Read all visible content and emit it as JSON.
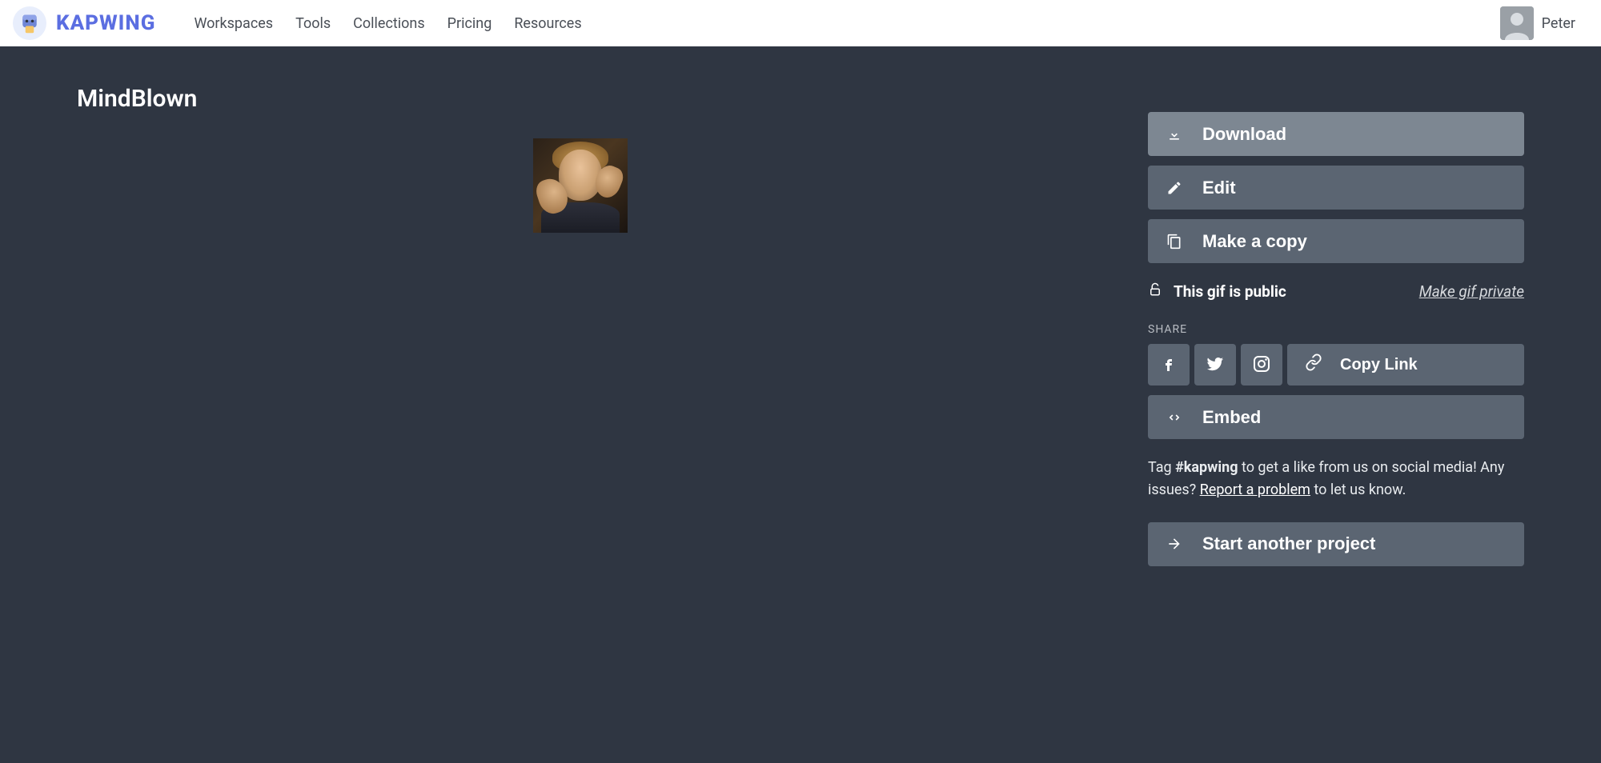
{
  "header": {
    "brand": "KAPWING",
    "nav": [
      "Workspaces",
      "Tools",
      "Collections",
      "Pricing",
      "Resources"
    ],
    "username": "Peter"
  },
  "project": {
    "title": "MindBlown"
  },
  "actions": {
    "download": "Download",
    "edit": "Edit",
    "copy": "Make a copy",
    "embed": "Embed",
    "start_another": "Start another project"
  },
  "status": {
    "text": "This gif is public",
    "link": "Make gif private"
  },
  "share": {
    "label": "SHARE",
    "copy_link": "Copy Link"
  },
  "tagline": {
    "prefix": "Tag ",
    "hashtag": "#kapwing",
    "mid": " to get a like from us on social media! Any issues? ",
    "report": "Report a problem",
    "suffix": " to let us know."
  }
}
